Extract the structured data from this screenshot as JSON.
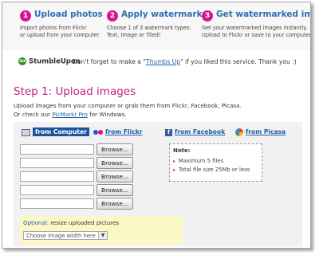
{
  "steps": [
    {
      "num": "1",
      "title": "Upload photos",
      "desc": "Import photos from Flickr\nor upload from your computer"
    },
    {
      "num": "2",
      "title": "Apply watermark",
      "desc": "Choose 1 of 3 watermark types:\nText, Image or Tiled!"
    },
    {
      "num": "3",
      "title": "Get watermarked images",
      "desc": "Get your watermarked images instantly.\nUpload to Flickr or save to your computer."
    }
  ],
  "stumble": {
    "logo_text": "StumbleUpon",
    "msg_before": "Don't forget to make a \"",
    "link": "Thumbs Up",
    "msg_after": "\" if you liked this service. Thank you :)"
  },
  "upload": {
    "heading": "Step 1: Upload images",
    "intro_line1": "Upload images from your computer or grab them from Flickr, Facebook, Picasa.",
    "intro_line2_before": "Or check our ",
    "intro_link": "PicMarkr Pro",
    "intro_line2_after": " for Windows.",
    "sources": [
      {
        "label": "from Computer",
        "icon": "computer-icon"
      },
      {
        "label": "from Flickr",
        "icon": "flickr-icon"
      },
      {
        "label": "from Facebook",
        "icon": "facebook-icon"
      },
      {
        "label": "from Picasa",
        "icon": "picasa-icon"
      }
    ],
    "browse_label": "Browse...",
    "note": {
      "title": "Note:",
      "items": [
        "Maximum 5 files",
        "Total file size 25Mb or less"
      ]
    },
    "optional": {
      "label1": "Optional",
      "label2": ": resize uploaded pictures",
      "select_value": "Choose image width here"
    }
  }
}
